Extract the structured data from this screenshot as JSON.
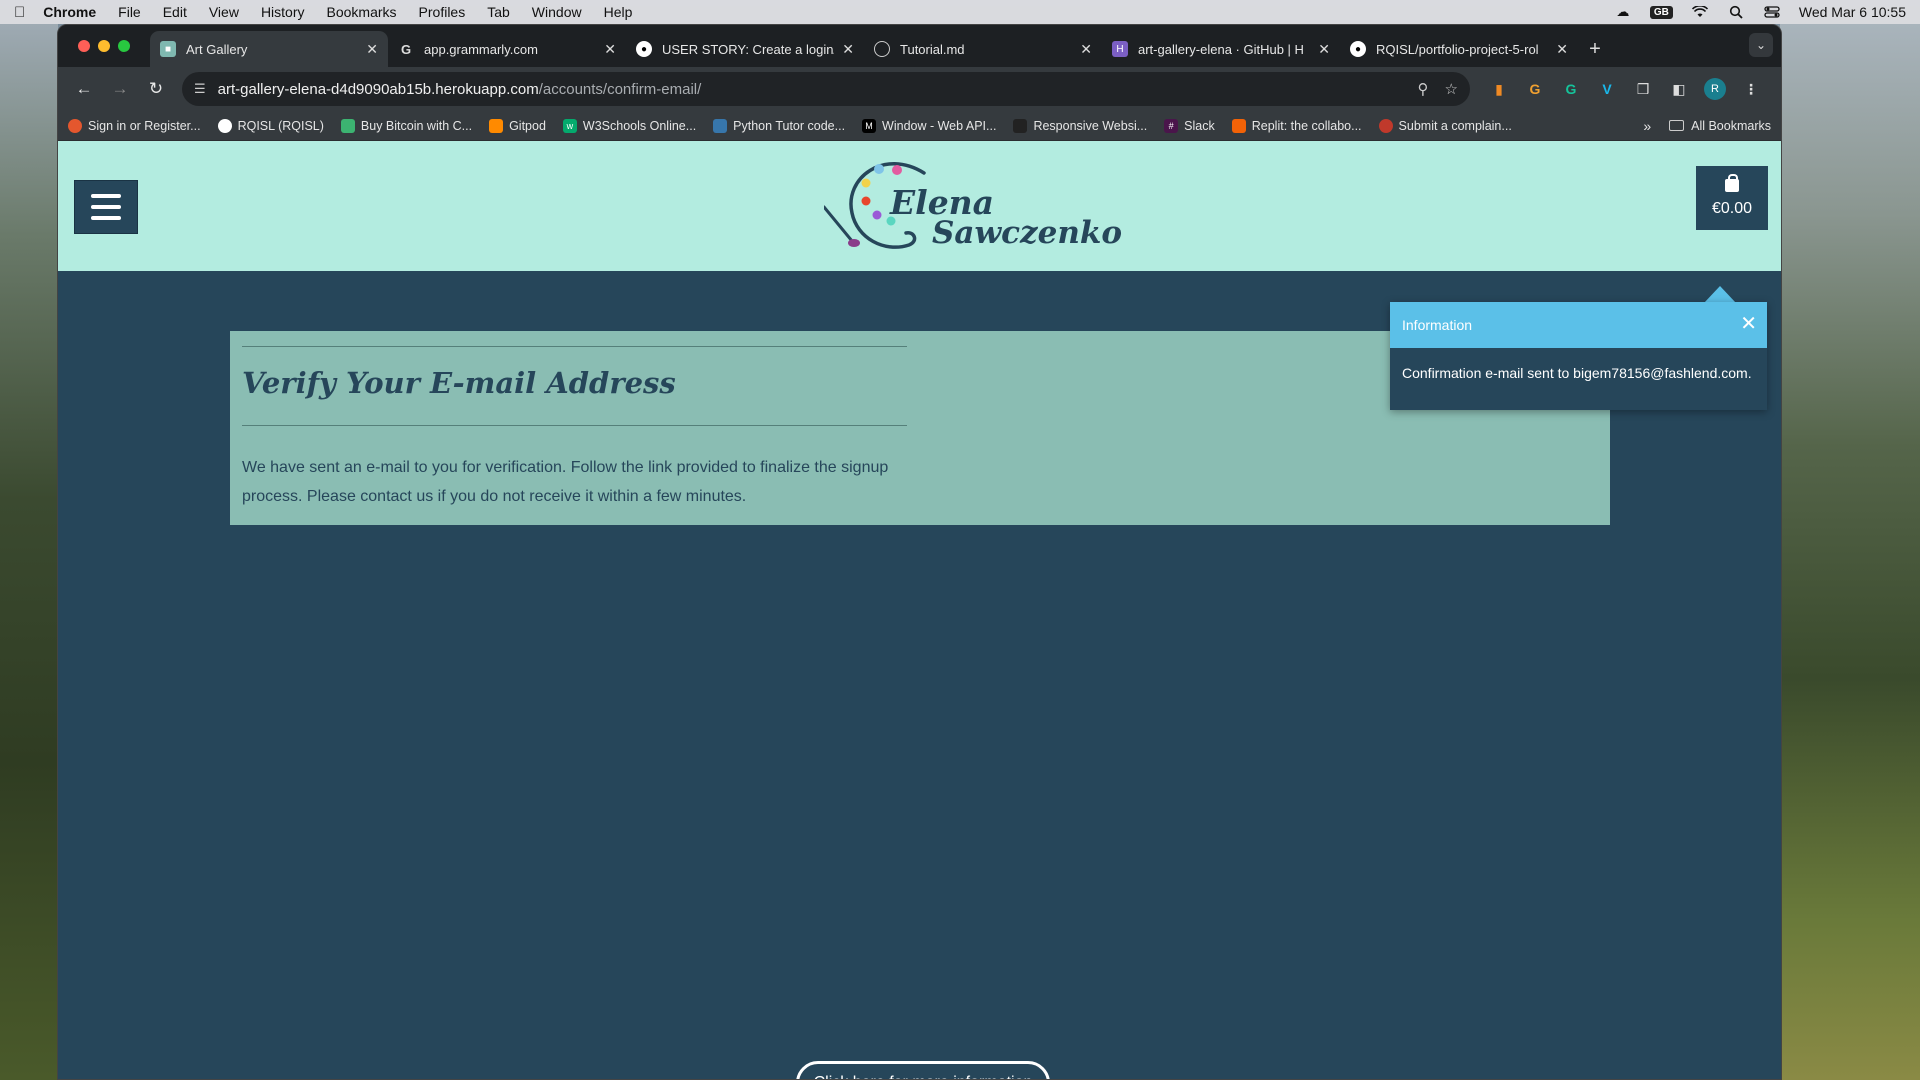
{
  "menubar": {
    "app": "Chrome",
    "items": [
      "File",
      "Edit",
      "View",
      "History",
      "Bookmarks",
      "Profiles",
      "Tab",
      "Window",
      "Help"
    ],
    "keyboard_badge": "GB",
    "datetime": "Wed Mar 6  10:55"
  },
  "tabs": [
    {
      "title": "Art Gallery",
      "active": true
    },
    {
      "title": "app.grammarly.com",
      "active": false
    },
    {
      "title": "USER STORY: Create a login/l",
      "active": false
    },
    {
      "title": "Tutorial.md",
      "active": false
    },
    {
      "title": "art-gallery-elena · GitHub | H",
      "active": false
    },
    {
      "title": "RQISL/portfolio-project-5-rol",
      "active": false
    }
  ],
  "omnibox": {
    "url_host": "art-gallery-elena-d4d9090ab15b.herokuapp.com",
    "url_path": "/accounts/confirm-email/"
  },
  "profile_initial": "R",
  "bookmarks": {
    "items": [
      "Sign in or Register...",
      "RQISL (RQISL)",
      "Buy Bitcoin with C...",
      "Gitpod",
      "W3Schools Online...",
      "Python Tutor code...",
      "Window - Web API...",
      "Responsive Websi...",
      "Slack",
      "Replit: the collabo...",
      "Submit a complain..."
    ],
    "more": "»",
    "all_bookmarks": "All Bookmarks"
  },
  "site": {
    "logo_line1": "Elena",
    "logo_line2": "Sawczenko",
    "bag_total": "€0.00"
  },
  "card": {
    "title": "Verify Your E-mail Address",
    "body": "We have sent an e-mail to you for verification. Follow the link provided to finalize the signup process. Please contact us if you do not receive it within a few minutes."
  },
  "toast": {
    "header": "Information",
    "message": "Confirmation e-mail sent to bigem78156@fashlend.com."
  },
  "footer_button": "Click here for more information"
}
